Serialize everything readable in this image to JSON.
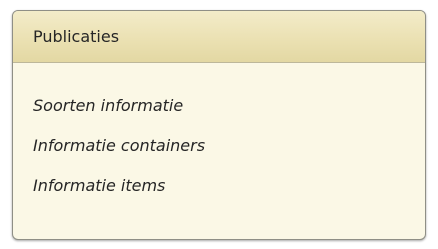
{
  "panel": {
    "title": "Publicaties",
    "items": [
      {
        "label": "Soorten informatie"
      },
      {
        "label": "Informatie containers"
      },
      {
        "label": "Informatie items"
      }
    ]
  }
}
